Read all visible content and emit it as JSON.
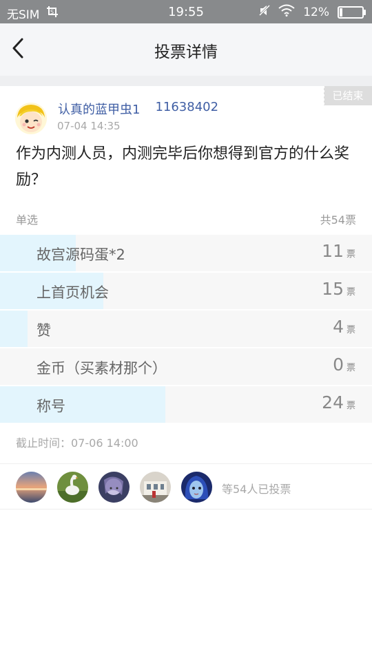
{
  "status_bar": {
    "carrier": "无SIM",
    "time": "19:55",
    "battery": "12%",
    "battery_level": 0.12
  },
  "header": {
    "title": "投票详情",
    "back_icon": "chevron-left-icon"
  },
  "post": {
    "status_badge": "已结束",
    "author": "认真的蓝甲虫1",
    "author_id": "11638402",
    "time": "07-04 14:35",
    "question": "作为内测人员，内测完毕后你想得到官方的什么奖励？"
  },
  "poll": {
    "type_label": "单选",
    "total_label": "共54票",
    "vote_unit": "票",
    "options": [
      {
        "label": "故宫源码蛋*2",
        "votes": "11"
      },
      {
        "label": "上首页机会",
        "votes": "15"
      },
      {
        "label": "赞",
        "votes": "4"
      },
      {
        "label": "金币（买素材那个）",
        "votes": "0"
      },
      {
        "label": "称号",
        "votes": "24"
      }
    ],
    "deadline": "截止时间：07-06 14:00"
  },
  "voters": {
    "summary": "等54人已投票"
  },
  "colors": {
    "accent": "#3f5ea4",
    "bar_fill": "#e3f5fd",
    "option_bg": "#f7f7f7",
    "status_bar": "#888a8c"
  }
}
